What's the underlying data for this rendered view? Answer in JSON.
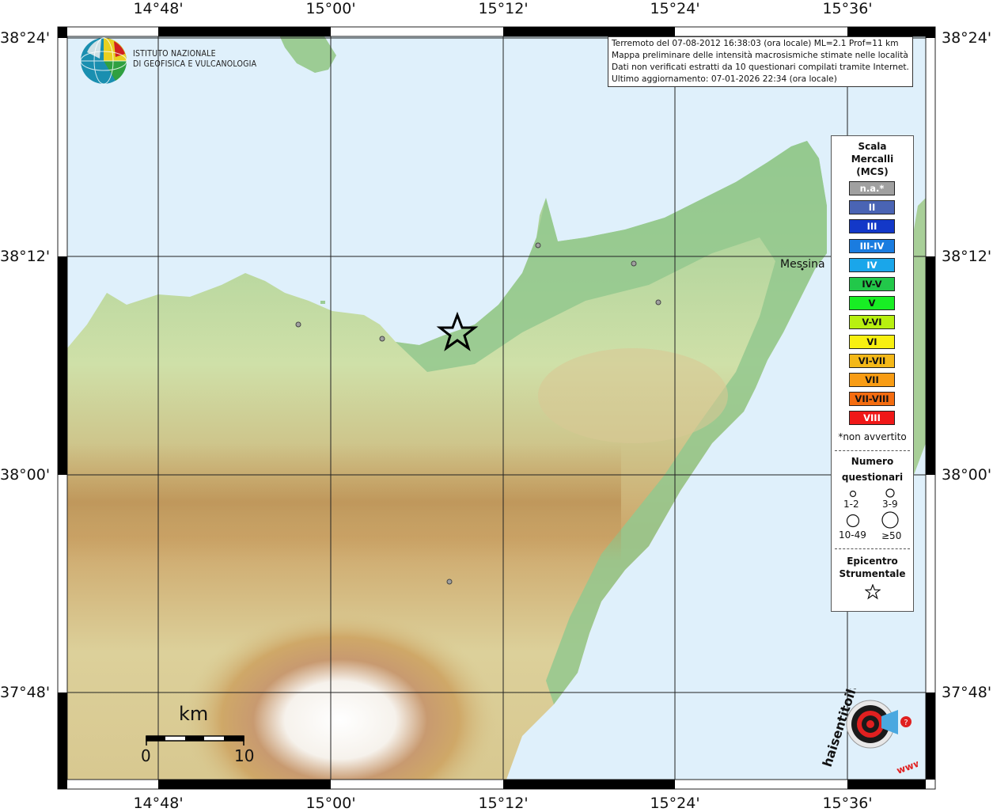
{
  "map": {
    "longitude_ticks": [
      "14°48'",
      "15°00'",
      "15°12'",
      "15°24'",
      "15°36'"
    ],
    "latitude_ticks": [
      "38°24'",
      "38°12'",
      "38°00'",
      "37°48'"
    ],
    "city_label": "Messina"
  },
  "info": {
    "line1": "Terremoto del 07-08-2012 16:38:03 (ora locale) ML=2.1 Prof=11 km",
    "line2": "Mappa preliminare delle intensità macrosismiche stimate nelle località",
    "line3": "Dati non verificati estratti da 10 questionari compilati tramite Internet.",
    "line4": "Ultimo aggiornamento: 07-01-2026 22:34 (ora locale)"
  },
  "ingv": {
    "line1": "ISTITUTO NAZIONALE",
    "line2": "DI GEOFISICA E VULCANOLOGIA"
  },
  "legend": {
    "title1": "Scala",
    "title2": "Mercalli",
    "title3": "(MCS)",
    "classes": [
      {
        "label": "n.a.*",
        "color": "#a0a0a0",
        "text_color": "#ffffff"
      },
      {
        "label": "II",
        "color": "#4a64b4",
        "text_color": "#ffffff"
      },
      {
        "label": "III",
        "color": "#1338c8",
        "text_color": "#ffffff"
      },
      {
        "label": "III-IV",
        "color": "#1a7ce0",
        "text_color": "#ffffff"
      },
      {
        "label": "IV",
        "color": "#1aa6ea",
        "text_color": "#ffffff"
      },
      {
        "label": "IV-V",
        "color": "#22c84a",
        "text_color": "#111111"
      },
      {
        "label": "V",
        "color": "#18ee24",
        "text_color": "#111111"
      },
      {
        "label": "V-VI",
        "color": "#b8f010",
        "text_color": "#111111"
      },
      {
        "label": "VI",
        "color": "#f8f010",
        "text_color": "#111111"
      },
      {
        "label": "VI-VII",
        "color": "#f4b818",
        "text_color": "#111111"
      },
      {
        "label": "VII",
        "color": "#f89c14",
        "text_color": "#111111"
      },
      {
        "label": "VII-VIII",
        "color": "#f46c10",
        "text_color": "#111111"
      },
      {
        "label": "VIII",
        "color": "#f01818",
        "text_color": "#ffffff"
      }
    ],
    "note": "*non avvertito",
    "questionnaires_title1": "Numero",
    "questionnaires_title2": "questionari",
    "q_labels": [
      "1-2",
      "3-9",
      "10-49",
      "≥50"
    ],
    "epicenter_title1": "Epicentro",
    "epicenter_title2": "Strumentale"
  },
  "scalebar": {
    "unit": "km",
    "start": "0",
    "end": "10"
  },
  "watermark": {
    "text": "haisentitoilterremoto.it",
    "url_prefix": "www."
  },
  "colors": {
    "sea": "#dff0fb",
    "lowland": "#8cc48c",
    "hills": "#d8d8a0",
    "mountains": "#c8a060",
    "summit": "#ffffff"
  }
}
